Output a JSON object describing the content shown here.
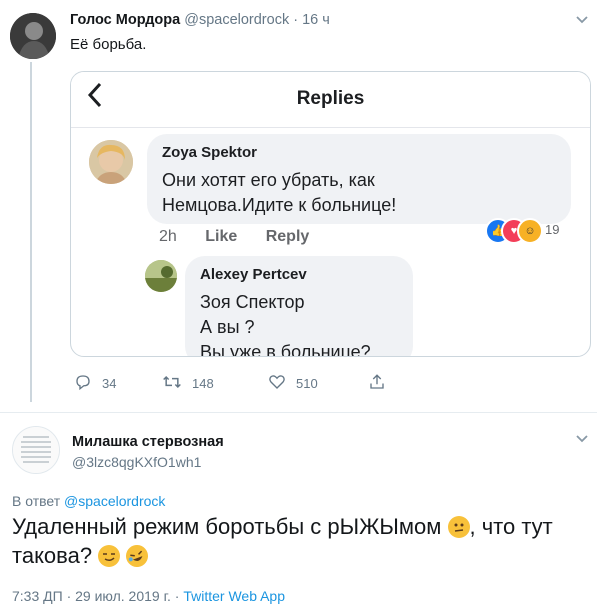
{
  "tweet": {
    "author_name": "Голос Мордора",
    "handle": "@spacelordrock",
    "separator": "·",
    "time": "16 ч",
    "text": "Её борьба.",
    "actions": {
      "replies": "34",
      "retweets": "148",
      "likes": "510"
    }
  },
  "embedded": {
    "title": "Replies",
    "comment1": {
      "name": "Zoya Spektor",
      "text": "Они хотят его убрать, как\nНемцова.Идите к больнице!",
      "time": "2h",
      "like": "Like",
      "reply": "Reply",
      "reaction_count": "19"
    },
    "comment2": {
      "name": "Alexey Pertcev",
      "text": "Зоя Спектор\nА вы ?\nВы уже в больнице?"
    }
  },
  "reply": {
    "author_name": "Милашка стервозная",
    "handle": "@3lzc8qgKXfO1wh1",
    "reply_prefix": "В ответ",
    "reply_to": "@spacelordrock",
    "text_part1": "Удаленный режим боротьбы с рЫЖЫмом",
    "text_part2": ", что тут такова?",
    "time": "7:33 ДП · 29 июл. 2019 г.",
    "sep": " · ",
    "source": "Twitter Web App"
  },
  "icons": [
    "reply-icon",
    "retweet-icon",
    "like-icon",
    "share-icon",
    "chevron-down-icon",
    "back-arrow-icon"
  ],
  "colors": {
    "accent": "#1b95e0",
    "muted": "#657786",
    "fb_bubble": "#f0f2f5"
  }
}
